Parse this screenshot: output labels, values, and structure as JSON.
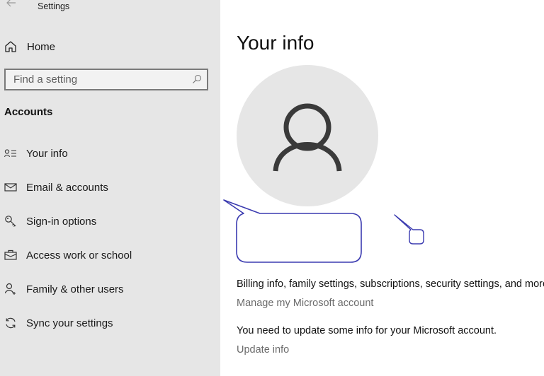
{
  "window": {
    "title": "Settings",
    "back_icon": "back-arrow-icon"
  },
  "sidebar": {
    "home": {
      "label": "Home",
      "icon": "home-icon"
    },
    "search": {
      "placeholder": "Find a setting",
      "value": "",
      "icon": "search-icon"
    },
    "section_title": "Accounts",
    "items": [
      {
        "label": "Your info",
        "icon": "contact-info-icon",
        "selected": true
      },
      {
        "label": "Email & accounts",
        "icon": "mail-icon",
        "selected": false
      },
      {
        "label": "Sign-in options",
        "icon": "key-icon",
        "selected": false
      },
      {
        "label": "Access work or school",
        "icon": "briefcase-icon",
        "selected": false
      },
      {
        "label": "Family & other users",
        "icon": "add-person-icon",
        "selected": false
      },
      {
        "label": "Sync your settings",
        "icon": "sync-icon",
        "selected": false
      }
    ]
  },
  "main": {
    "title": "Your info",
    "avatar_icon": "person-icon",
    "microsoft_account": {
      "description": "Billing info, family settings, subscriptions, security settings, and more",
      "link": "Manage my Microsoft account"
    },
    "update_notice": {
      "description": "You need to update some info for your Microsoft account.",
      "link": "Update info"
    }
  },
  "annotations": {
    "callout_color": "#3b3bb0",
    "callouts": [
      "large-speech-bubble",
      "small-speech-bubble"
    ]
  }
}
